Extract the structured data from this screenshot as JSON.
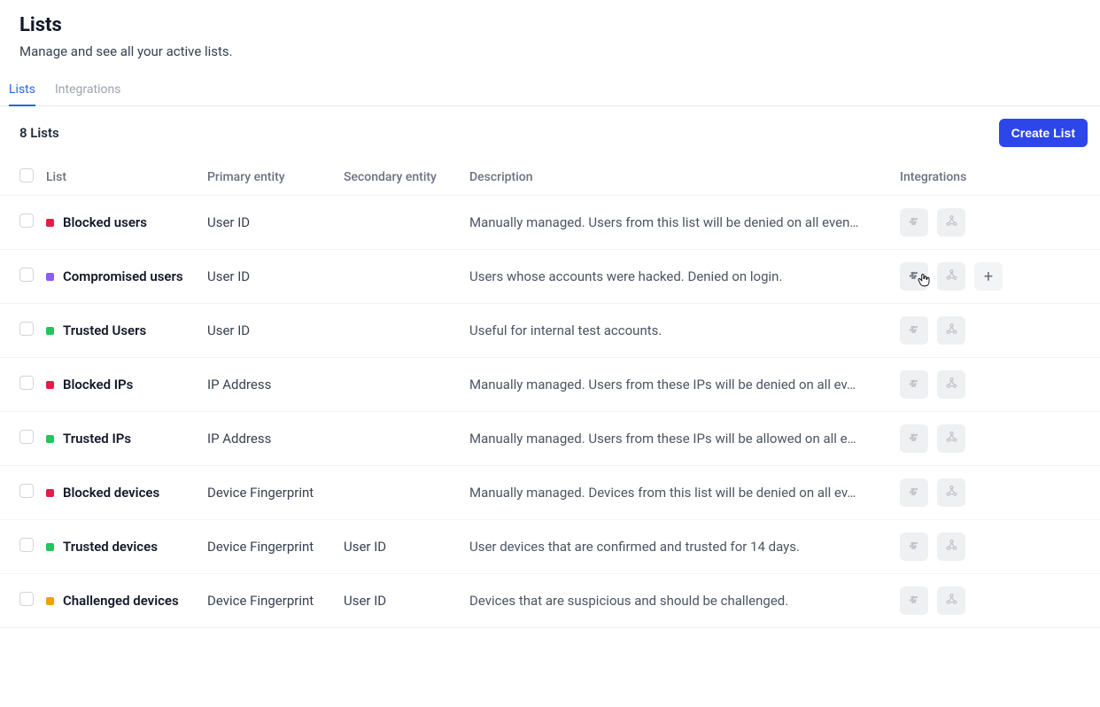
{
  "header": {
    "title": "Lists",
    "subtitle": "Manage and see all your active lists."
  },
  "tabs": [
    {
      "label": "Lists",
      "active": true
    },
    {
      "label": "Integrations",
      "active": false
    }
  ],
  "toolbar": {
    "count_label": "8 Lists",
    "create_label": "Create List"
  },
  "columns": {
    "list": "List",
    "primary": "Primary entity",
    "secondary": "Secondary entity",
    "description": "Description",
    "integrations": "Integrations"
  },
  "colors": {
    "red": "#e11d48",
    "purple": "#8b5cf6",
    "green": "#22c55e",
    "orange": "#f59e0b"
  },
  "rows": [
    {
      "color": "red",
      "name": "Blocked users",
      "primary": "User ID",
      "secondary": "",
      "description": "Manually managed. Users from this list will be denied on all even…",
      "hovered": false
    },
    {
      "color": "purple",
      "name": "Compromised users",
      "primary": "User ID",
      "secondary": "",
      "description": "Users whose accounts were hacked. Denied on login.",
      "hovered": true
    },
    {
      "color": "green",
      "name": "Trusted Users",
      "primary": "User ID",
      "secondary": "",
      "description": "Useful for internal test accounts.",
      "hovered": false
    },
    {
      "color": "red",
      "name": "Blocked IPs",
      "primary": "IP Address",
      "secondary": "",
      "description": "Manually managed. Users from these IPs will be denied on all ev…",
      "hovered": false
    },
    {
      "color": "green",
      "name": "Trusted IPs",
      "primary": "IP Address",
      "secondary": "",
      "description": "Manually managed. Users from these IPs will be allowed on all e…",
      "hovered": false
    },
    {
      "color": "red",
      "name": "Blocked devices",
      "primary": "Device Fingerprint",
      "secondary": "",
      "description": "Manually managed. Devices from this list will be denied on all ev…",
      "hovered": false
    },
    {
      "color": "green",
      "name": "Trusted devices",
      "primary": "Device Fingerprint",
      "secondary": "User ID",
      "description": "User devices that are confirmed and trusted for 14 days.",
      "hovered": false
    },
    {
      "color": "orange",
      "name": "Challenged devices",
      "primary": "Device Fingerprint",
      "secondary": "User ID",
      "description": "Devices that are suspicious and should be challenged.",
      "hovered": false
    }
  ]
}
